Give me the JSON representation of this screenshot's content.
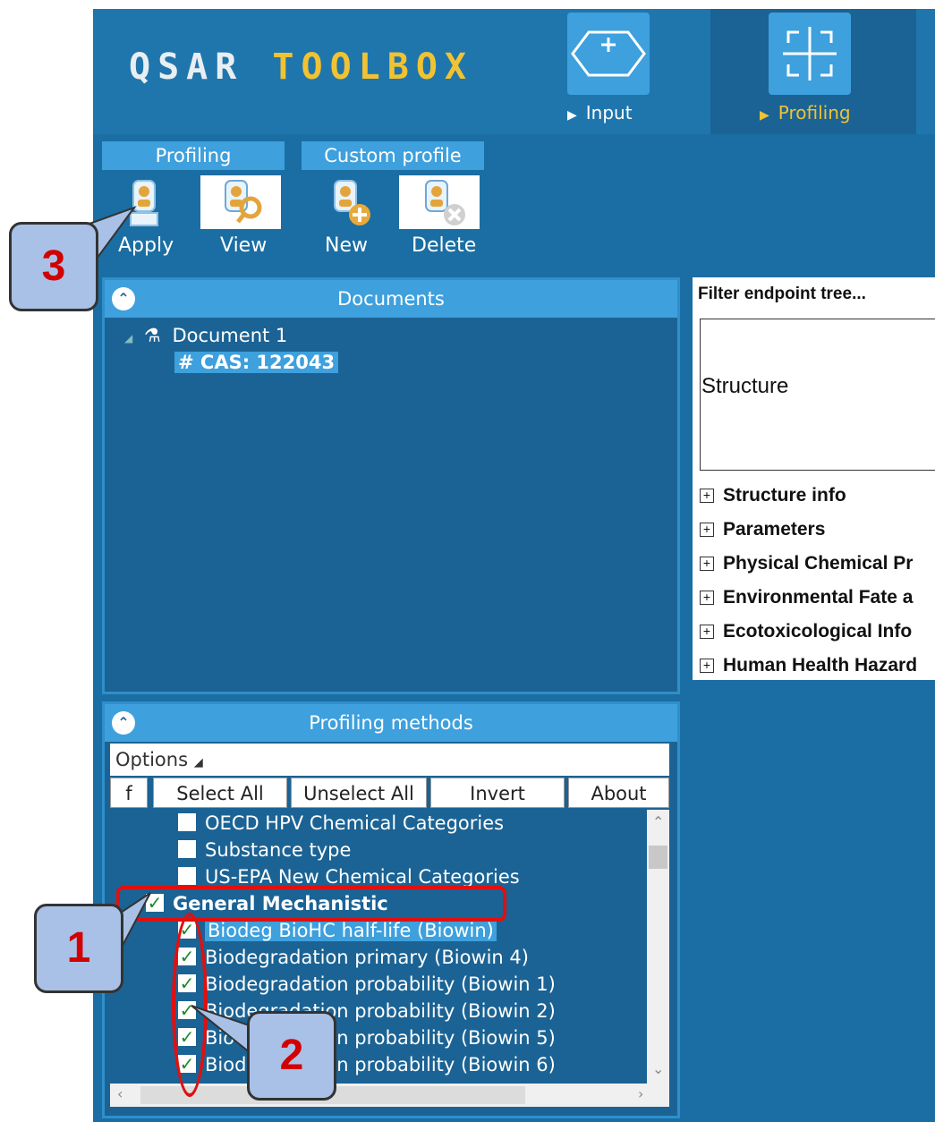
{
  "header": {
    "logo_part1": "QSAR ",
    "logo_part2": "TOOLBOX",
    "nav_input": "Input",
    "nav_profiling": "Profiling"
  },
  "ribbon": {
    "group_profiling": "Profiling",
    "group_custom": "Custom profile",
    "apply": "Apply",
    "view": "View",
    "new": "New",
    "delete": "Delete"
  },
  "documents": {
    "title": "Documents",
    "doc_name": "Document 1",
    "chemical": "# CAS: 122043"
  },
  "profiling_methods": {
    "title": "Profiling methods",
    "options": "Options",
    "buttons": [
      "f",
      "Select All",
      "Unselect All",
      "Invert",
      "About"
    ],
    "items": [
      {
        "label": "OECD HPV Chemical Categories",
        "checked": false
      },
      {
        "label": "Substance type",
        "checked": false
      },
      {
        "label": "US-EPA New Chemical Categories",
        "checked": false
      },
      {
        "label": "General Mechanistic",
        "checked": true
      },
      {
        "label": "Biodeg BioHC half-life (Biowin)",
        "checked": true
      },
      {
        "label": "Biodegradation primary (Biowin 4)",
        "checked": true
      },
      {
        "label": "Biodegradation probability (Biowin 1)",
        "checked": true
      },
      {
        "label": "Biodegradation probability (Biowin 2)",
        "checked": true
      },
      {
        "label": "Biodegradation probability (Biowin 5)",
        "checked": true
      },
      {
        "label": "Biodegradation probability (Biowin 6)",
        "checked": true
      }
    ]
  },
  "endpoint": {
    "filter": "Filter endpoint tree...",
    "structure": "Structure",
    "items": [
      "Structure info",
      "Parameters",
      "Physical Chemical Pr",
      "Environmental Fate a",
      "Ecotoxicological Info",
      "Human Health Hazard"
    ]
  },
  "callouts": {
    "one": "1",
    "two": "2",
    "three": "3"
  },
  "colors": {
    "accent": "#3ea0dd",
    "background": "#1b6394",
    "highlight": "#f1c232",
    "annotation": "#e01010"
  }
}
